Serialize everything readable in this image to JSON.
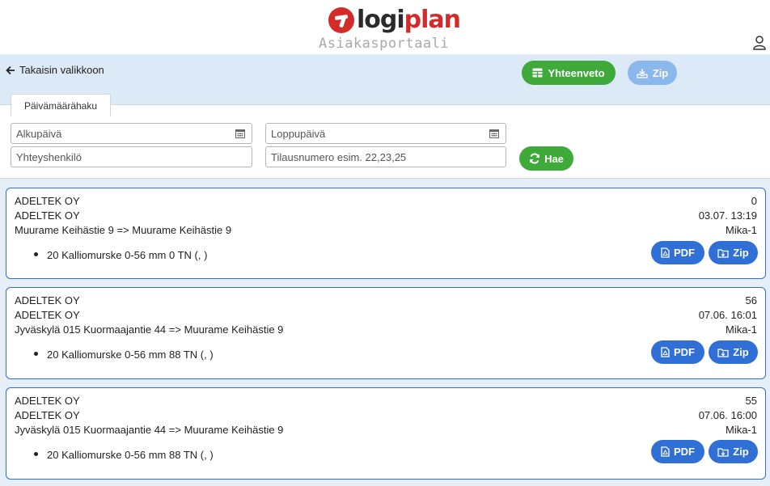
{
  "header": {
    "logo_part1": "logi",
    "logo_part2": "plan",
    "portal_title": "Asiakasportaali"
  },
  "topbar": {
    "back_label": "Takaisin valikkoon",
    "summary_label": "Yhteenveto",
    "zip_label": "Zip"
  },
  "search": {
    "tab_label": "Päivämäärähaku",
    "start_date_placeholder": "Alkupäivä",
    "end_date_placeholder": "Loppupäivä",
    "contact_placeholder": "Yhteyshenkilö",
    "order_placeholder": "Tilausnumero esim. 22,23,25",
    "search_label": "Hae"
  },
  "cards": [
    {
      "company1": "ADELTEK OY",
      "company2": "ADELTEK OY",
      "route": "Muurame Keihästie 9 => Muurame Keihästie 9",
      "number": "0",
      "datetime": "03.07. 13:19",
      "user": "Mika-1",
      "item": "20 Kalliomurske 0-56 mm 0 TN (, )",
      "pdf_label": "PDF",
      "zip_label": "Zip"
    },
    {
      "company1": "ADELTEK OY",
      "company2": "ADELTEK OY",
      "route": "Jyväskylä 015 Kuormaajantie 44 => Muurame Keihästie 9",
      "number": "56",
      "datetime": "07.06. 16:01",
      "user": "Mika-1",
      "item": "20 Kalliomurske 0-56 mm 88 TN (, )",
      "pdf_label": "PDF",
      "zip_label": "Zip"
    },
    {
      "company1": "ADELTEK OY",
      "company2": "ADELTEK OY",
      "route": "Jyväskylä 015 Kuormaajantie 44 => Muurame Keihästie 9",
      "number": "55",
      "datetime": "07.06. 16:00",
      "user": "Mika-1",
      "item": "20 Kalliomurske 0-56 mm 88 TN (, )",
      "pdf_label": "PDF",
      "zip_label": "Zip"
    }
  ],
  "colors": {
    "brand_red": "#d42a2a",
    "green": "#3fa93a",
    "blue": "#2f6fd6",
    "light_blue": "#8ab7ec"
  }
}
